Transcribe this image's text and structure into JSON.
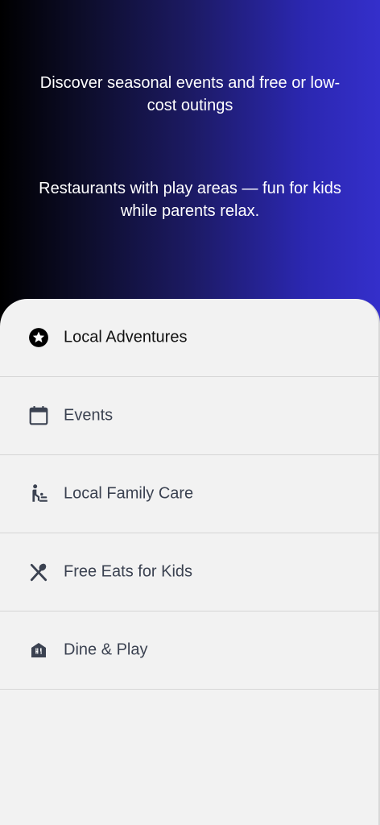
{
  "hero": {
    "line_1": "Discover seasonal events and free or low-cost outings",
    "line_2": "Restaurants with play areas — fun for kids while parents relax."
  },
  "menu": {
    "items": [
      {
        "label": "Local Adventures",
        "icon": "star-circle-icon",
        "active": true
      },
      {
        "label": "Events",
        "icon": "calendar-icon",
        "active": false
      },
      {
        "label": "Local Family Care",
        "icon": "baby-changing-icon",
        "active": false
      },
      {
        "label": "Free Eats for Kids",
        "icon": "utensils-crossed-icon",
        "active": false
      },
      {
        "label": "Dine & Play",
        "icon": "restaurant-house-icon",
        "active": false
      }
    ]
  },
  "colors": {
    "hero_gradient_start": "#000000",
    "hero_gradient_end": "#342fcb",
    "drawer_bg": "#f2f2f2",
    "label_text": "#3b4251",
    "active_text": "#111111"
  }
}
